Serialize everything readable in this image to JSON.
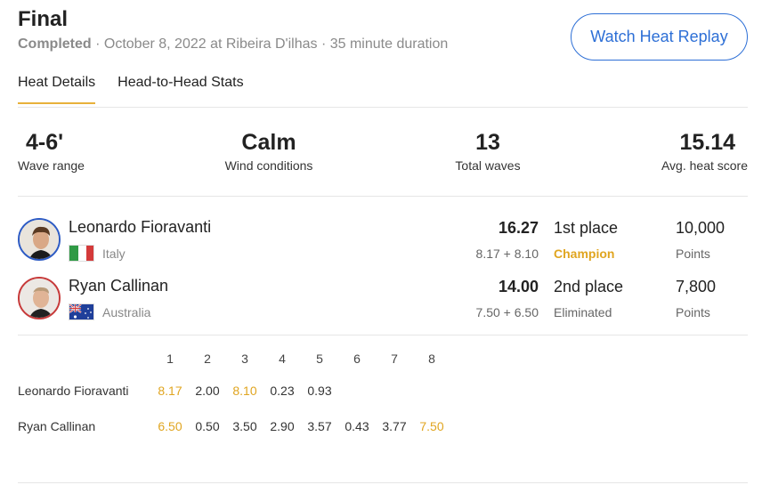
{
  "heat": {
    "title": "Final",
    "status": "Completed",
    "details": " · October 8, 2022 at Ribeira D'ilhas · 35 minute duration",
    "replay_label": "Watch Heat Replay"
  },
  "tabs": [
    {
      "label": "Heat Details",
      "active": true
    },
    {
      "label": "Head-to-Head Stats",
      "active": false
    }
  ],
  "stats": [
    {
      "value": "4-6'",
      "label": "Wave range"
    },
    {
      "value": "Calm",
      "label": "Wind conditions"
    },
    {
      "value": "13",
      "label": "Total waves"
    },
    {
      "value": "15.14",
      "label": "Avg. heat score"
    }
  ],
  "athletes": [
    {
      "name": "Leonardo Fioravanti",
      "country": "Italy",
      "total": "16.27",
      "breakdown": "8.17 + 8.10",
      "place": "1st place",
      "result": "Champion",
      "points": "10,000",
      "points_label": "Points"
    },
    {
      "name": "Ryan Callinan",
      "country": "Australia",
      "total": "14.00",
      "breakdown": "7.50 + 6.50",
      "place": "2nd place",
      "result": "Eliminated",
      "points": "7,800",
      "points_label": "Points"
    }
  ],
  "waves": {
    "headers": [
      "1",
      "2",
      "3",
      "4",
      "5",
      "6",
      "7",
      "8"
    ],
    "rows": [
      {
        "name": "Leonardo Fioravanti",
        "scores": [
          "8.17",
          "2.00",
          "8.10",
          "0.23",
          "0.93"
        ],
        "best": [
          0,
          2
        ]
      },
      {
        "name": "Ryan Callinan",
        "scores": [
          "6.50",
          "0.50",
          "3.50",
          "2.90",
          "3.57",
          "0.43",
          "3.77",
          "7.50"
        ],
        "best": [
          0,
          7
        ]
      }
    ]
  },
  "colors": {
    "accent": "#2d6fd6",
    "highlight": "#e0a520",
    "tab_underline": "#e8b13a"
  }
}
